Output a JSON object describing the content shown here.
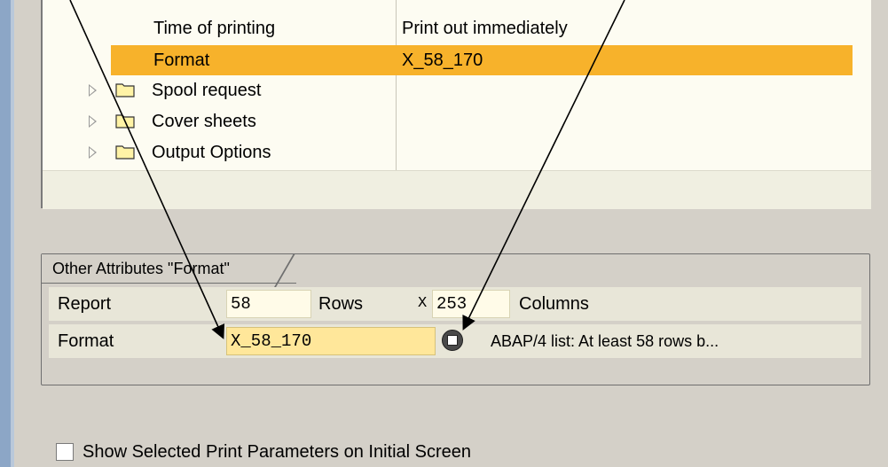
{
  "tree": {
    "rows": [
      {
        "label": "Time of printing",
        "value": "Print out immediately",
        "selected": false,
        "expandable": false
      },
      {
        "label": "Format",
        "value": "X_58_170",
        "selected": true,
        "expandable": false
      },
      {
        "label": "Spool request",
        "value": "",
        "selected": false,
        "expandable": true
      },
      {
        "label": "Cover sheets",
        "value": "",
        "selected": false,
        "expandable": true
      },
      {
        "label": "Output Options",
        "value": "",
        "selected": false,
        "expandable": true
      }
    ]
  },
  "attributes": {
    "title": "Other Attributes \"Format\"",
    "report_label": "Report",
    "rows_value": "58",
    "rows_label": "Rows",
    "x_label": "X",
    "columns_value": "253",
    "columns_label": "Columns",
    "format_label": "Format",
    "format_value": "X_58_170",
    "format_description": "ABAP/4 list: At least 58 rows b..."
  },
  "options": {
    "show_params_label": "Show Selected Print Parameters on Initial Screen",
    "show_params_checked": false
  },
  "colors": {
    "selected_row": "#f7b22b",
    "format_field": "#ffe79a",
    "panel": "#d4d0c8"
  }
}
